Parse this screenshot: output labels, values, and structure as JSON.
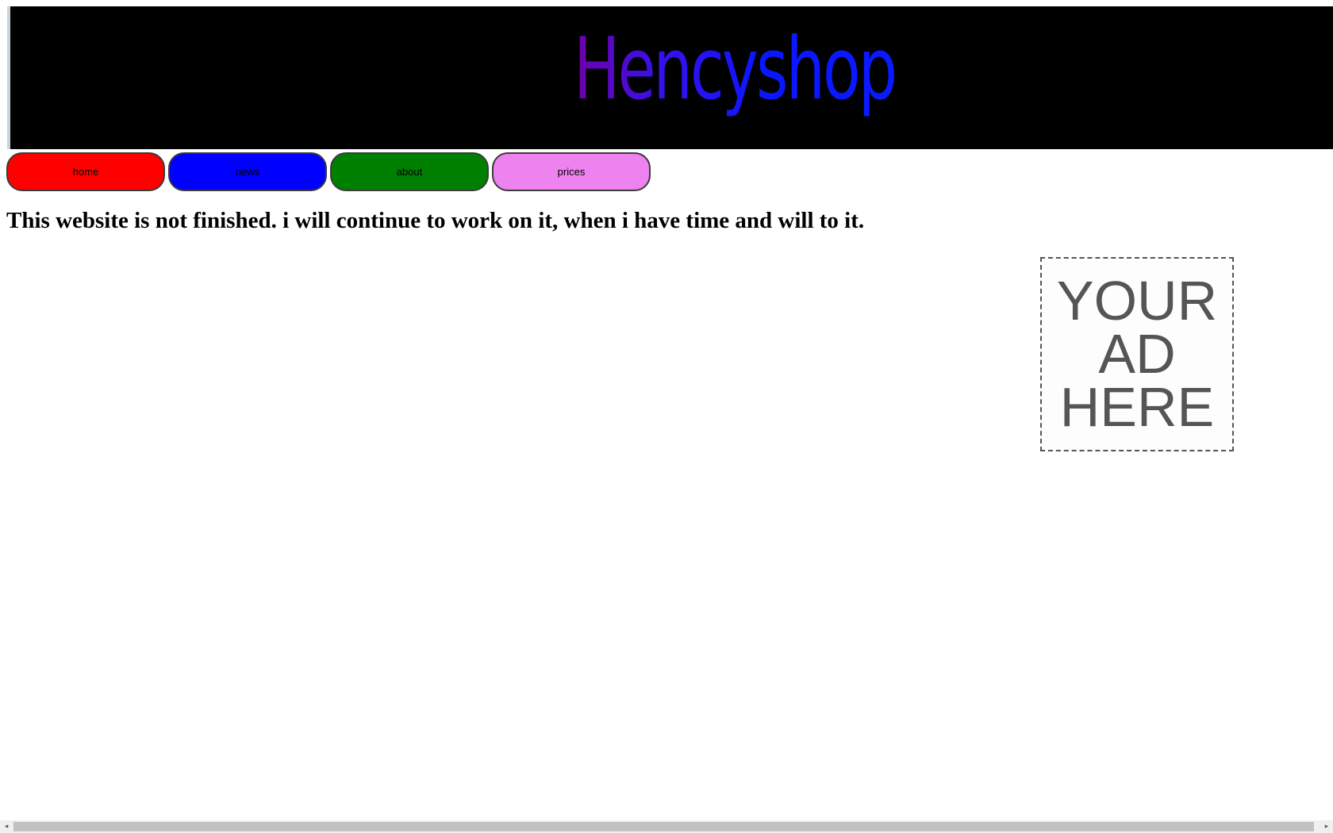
{
  "header": {
    "logo_text": "Hencyshop"
  },
  "nav": {
    "items": [
      {
        "label": "home",
        "color": "#ff0000"
      },
      {
        "label": "news",
        "color": "#0000ff"
      },
      {
        "label": "about",
        "color": "#008000"
      },
      {
        "label": "prices",
        "color": "#ee82ee"
      }
    ]
  },
  "main": {
    "notice": "This website is not finished. i will continue to work on it, when i have time and will to it."
  },
  "ad": {
    "line1": "YOUR",
    "line2": "AD",
    "line3": "HERE"
  },
  "scrollbar": {
    "left_arrow": "◂",
    "right_arrow": "▸"
  }
}
